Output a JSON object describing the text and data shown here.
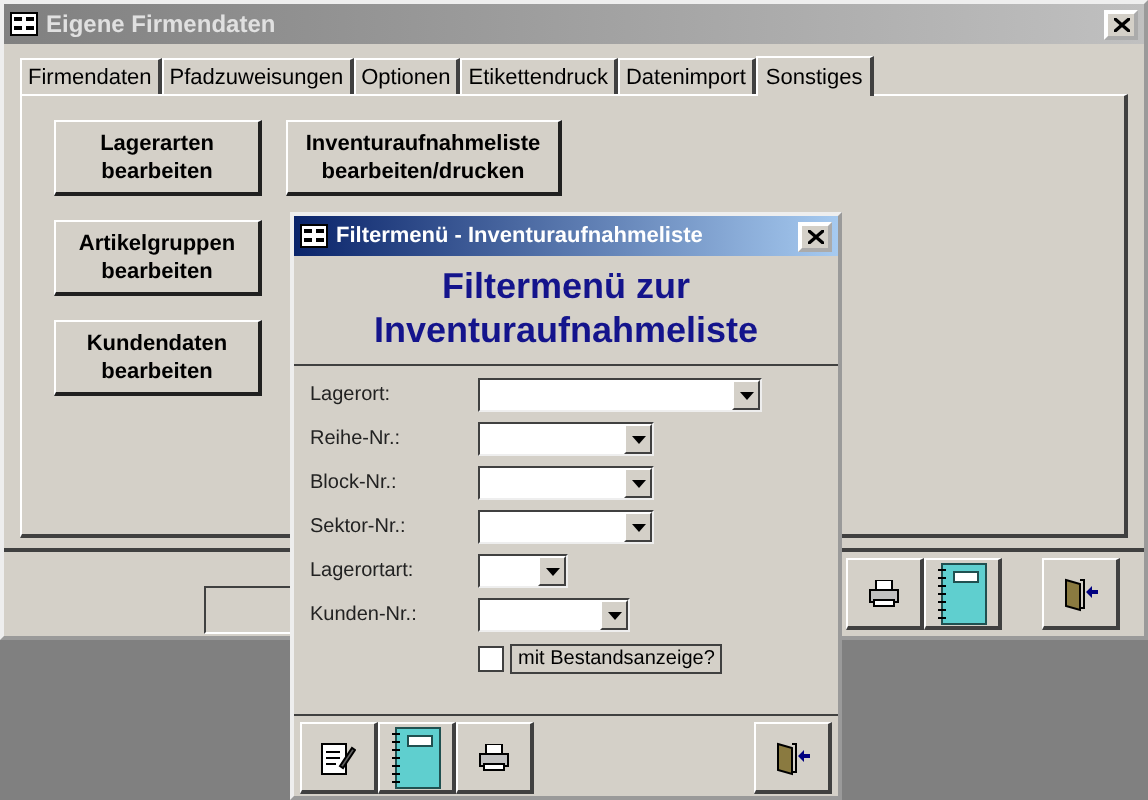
{
  "window": {
    "title": "Eigene Firmendaten"
  },
  "tabs": [
    {
      "label": "Firmendaten",
      "selected": false
    },
    {
      "label": "Pfadzuweisungen",
      "selected": false
    },
    {
      "label": "Optionen",
      "selected": false
    },
    {
      "label": "Etikettendruck",
      "selected": false
    },
    {
      "label": "Datenimport",
      "selected": false
    },
    {
      "label": "Sonstiges",
      "selected": true
    }
  ],
  "panel_buttons": [
    {
      "label": "Lagerarten bearbeiten"
    },
    {
      "label": "Artikelgruppen bearbeiten"
    },
    {
      "label": "Kundendaten bearbeiten"
    },
    {
      "label": "Inventuraufnahmeliste bearbeiten/drucken"
    }
  ],
  "toolbar": [
    {
      "kind": "printer"
    },
    {
      "kind": "notebook"
    },
    {
      "kind": "exit"
    }
  ],
  "dialog": {
    "title": "Filtermenü - Inventuraufnahmeliste",
    "heading": "Filtermenü zur Inventuraufnahmeliste",
    "fields": [
      {
        "label": "Lagerort:"
      },
      {
        "label": "Reihe-Nr.:"
      },
      {
        "label": "Block-Nr.:"
      },
      {
        "label": "Sektor-Nr.:"
      },
      {
        "label": "Lagerortart:"
      },
      {
        "label": "Kunden-Nr.:"
      }
    ],
    "checkbox": {
      "label": "mit Bestandsanzeige?",
      "checked": false
    },
    "toolbar": [
      {
        "kind": "edit"
      },
      {
        "kind": "notebook"
      },
      {
        "kind": "printer"
      },
      {
        "kind": "exit"
      }
    ]
  }
}
